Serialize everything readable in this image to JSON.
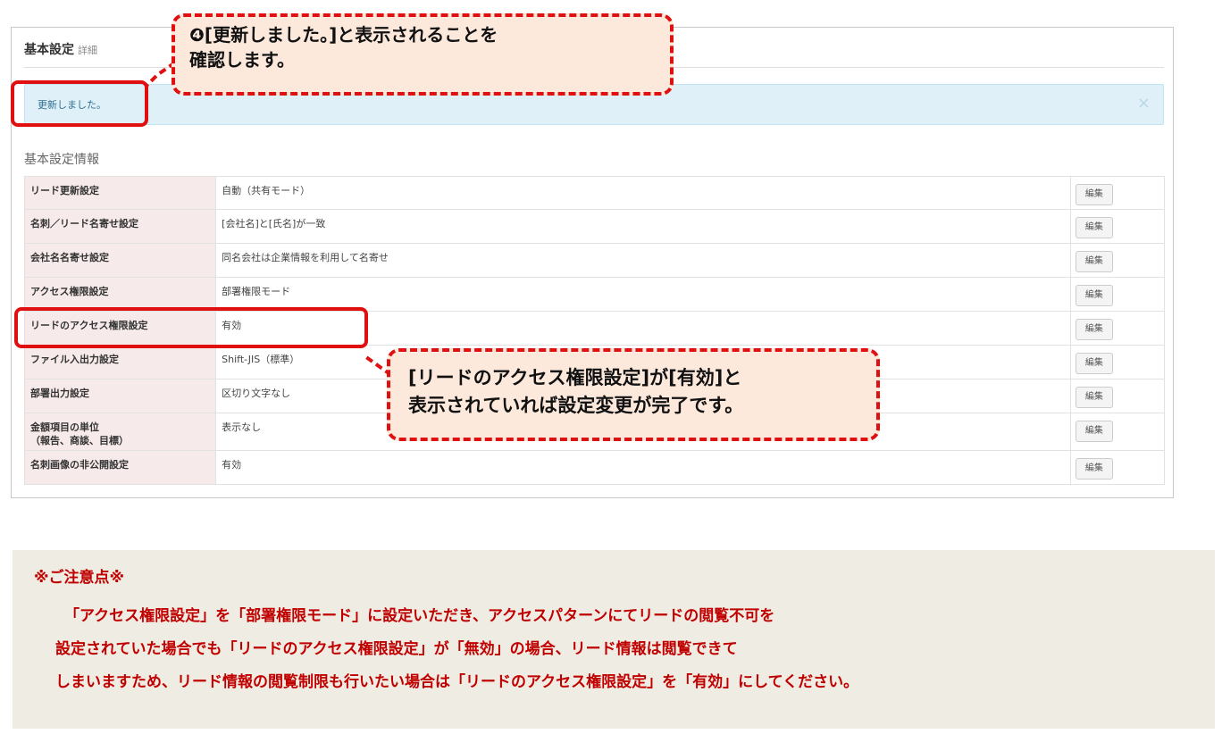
{
  "panel": {
    "title": "基本設定",
    "title_sub": "詳細",
    "alert_text": "更新しました。",
    "alert_close": "×",
    "section_title": "基本設定情報",
    "edit_label": "編集",
    "rows": [
      {
        "label": "リード更新設定",
        "value": "自動（共有モード）"
      },
      {
        "label": "名刺／リード名寄せ設定",
        "value": "[会社名]と[氏名]が一致"
      },
      {
        "label": "会社名名寄せ設定",
        "value": "同名会社は企業情報を利用して名寄せ"
      },
      {
        "label": "アクセス権限設定",
        "value": "部署権限モード"
      },
      {
        "label": "リードのアクセス権限設定",
        "value": "有効"
      },
      {
        "label": "ファイル入出力設定",
        "value": "Shift-JIS（標準）"
      },
      {
        "label": "部署出力設定",
        "value": "区切り文字なし"
      },
      {
        "label": "金額項目の単位\n（報告、商談、目標）",
        "value": "表示なし"
      },
      {
        "label": "名刺画像の非公開設定",
        "value": "有効"
      }
    ]
  },
  "callouts": {
    "step4_line1": "❹[更新しました。]と表示されることを",
    "step4_line2": "確認します。",
    "result_line1": "[リードのアクセス権限設定]が[有効]と",
    "result_line2": "表示されていれば設定変更が完了です。"
  },
  "notice": {
    "heading": "※ご注意点※",
    "line1": "「アクセス権限設定」を「部署権限モード」に設定いただき、アクセスパターンにてリードの閲覧不可を",
    "line2": "設定されていた場合でも「リードのアクセス権限設定」が「無効」の場合、リード情報は閲覧できて",
    "line3": "しまいますため、リード情報の閲覧制限も行いたい場合は「リードのアクセス権限設定」を「有効」にしてください。"
  },
  "colors": {
    "accent_red": "#e01010",
    "notice_text": "#c00000",
    "callout_bg": "#fce9dc"
  }
}
